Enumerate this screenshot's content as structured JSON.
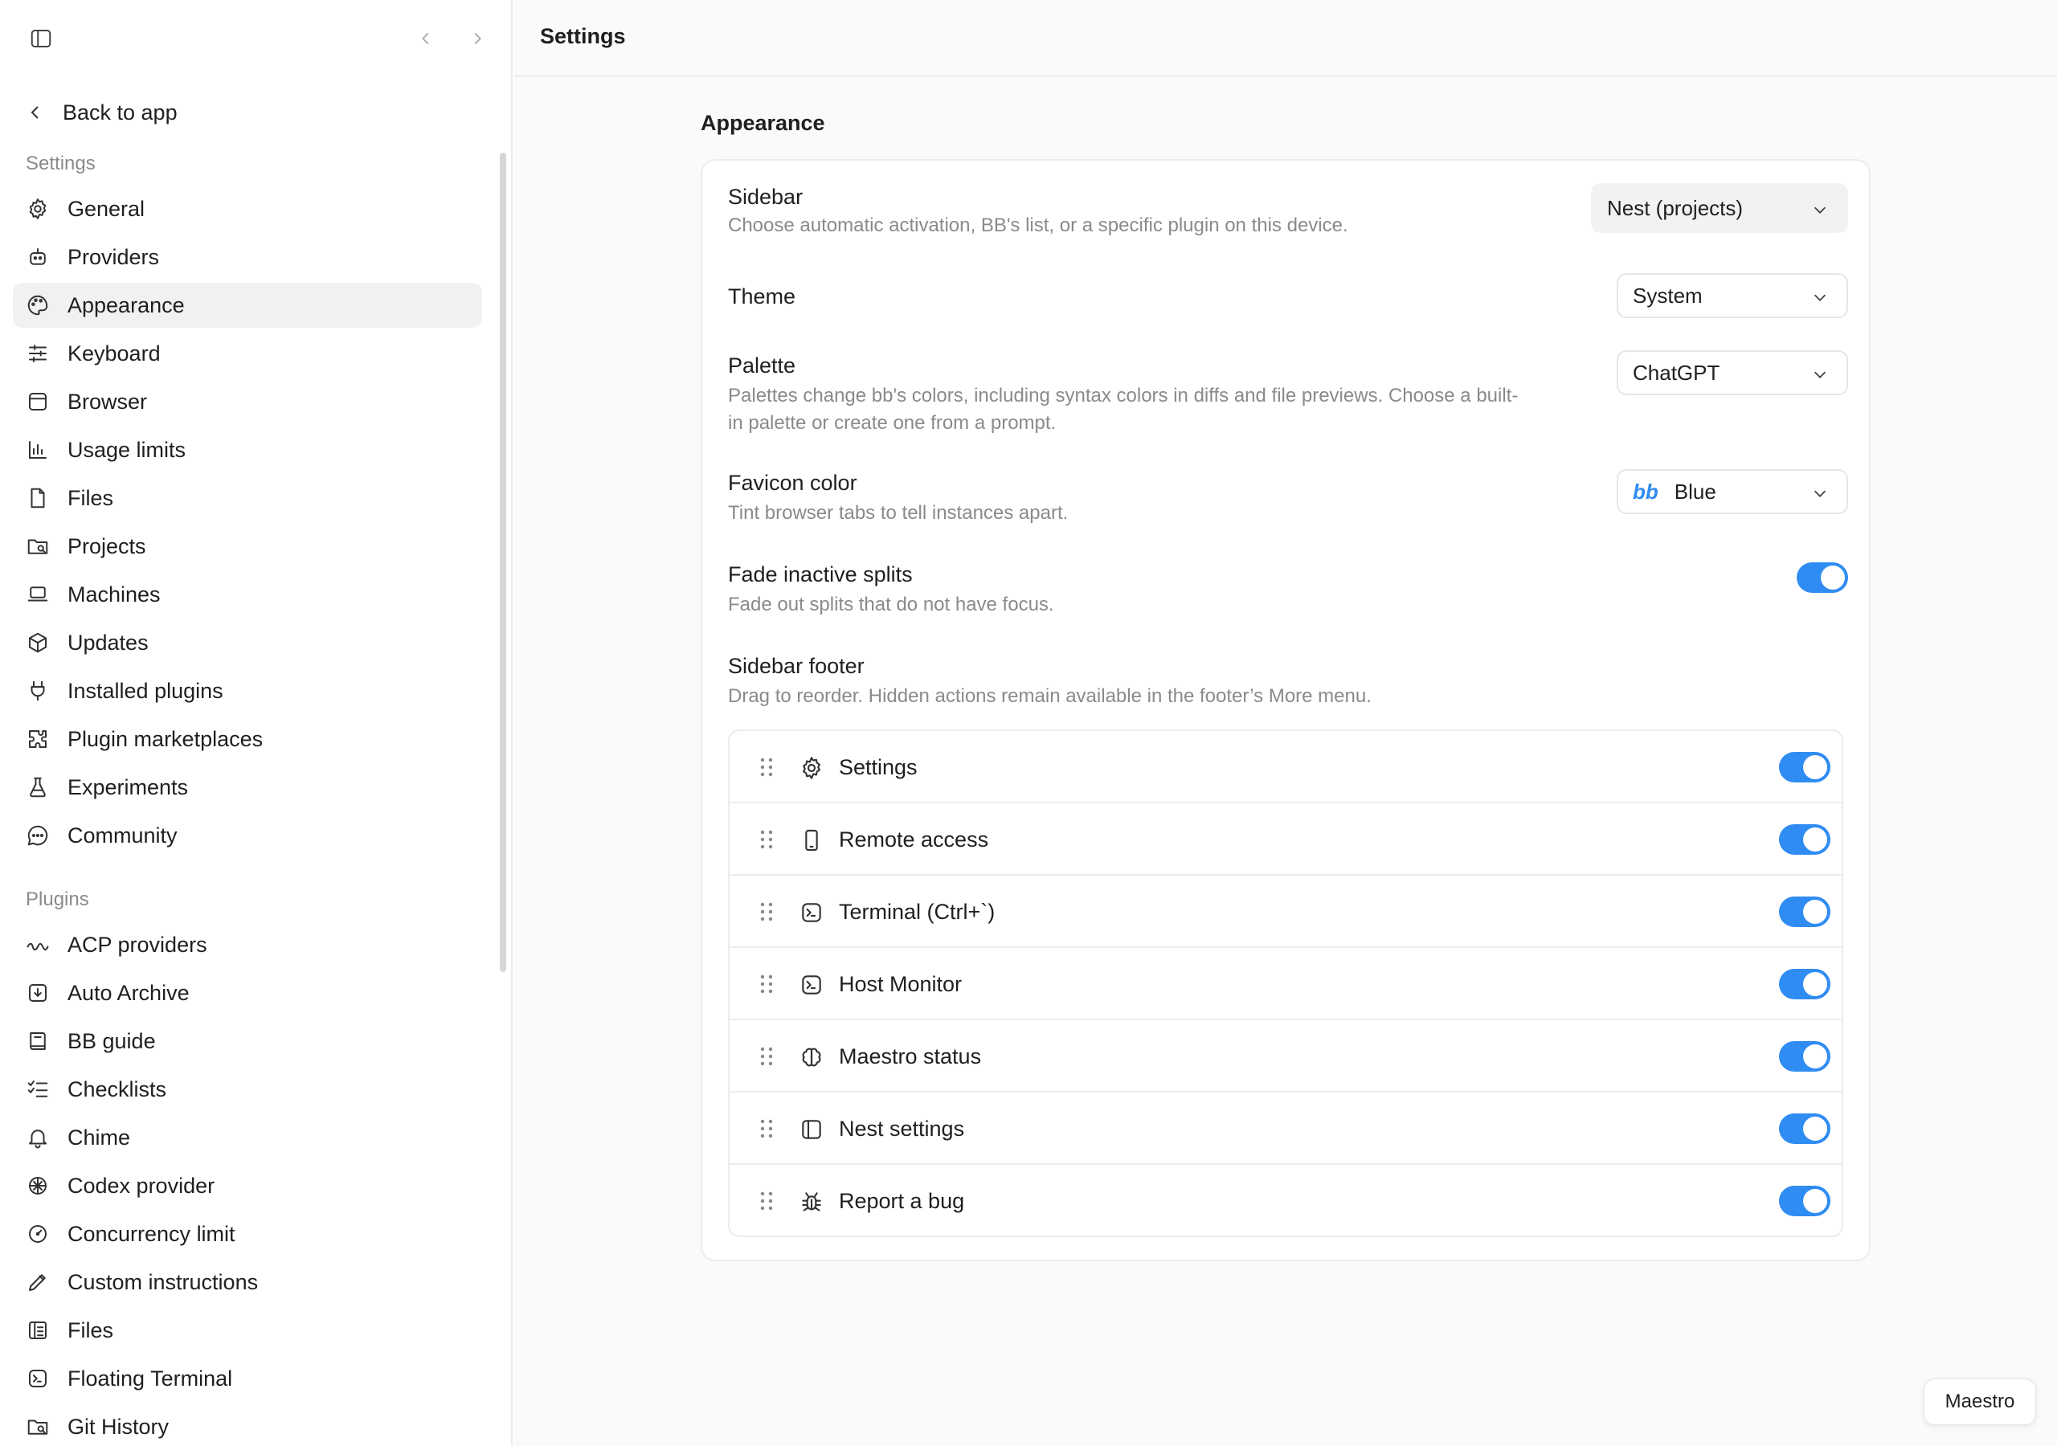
{
  "sidebar": {
    "back_label": "Back to app",
    "settings_title": "Settings",
    "plugins_title": "Plugins",
    "settings_items": [
      {
        "label": "General",
        "icon": "gear-icon"
      },
      {
        "label": "Providers",
        "icon": "robot-icon"
      },
      {
        "label": "Appearance",
        "icon": "palette-icon",
        "active": true
      },
      {
        "label": "Keyboard",
        "icon": "sliders-icon"
      },
      {
        "label": "Browser",
        "icon": "browser-window-icon"
      },
      {
        "label": "Usage limits",
        "icon": "bar-chart-icon"
      },
      {
        "label": "Files",
        "icon": "file-icon"
      },
      {
        "label": "Projects",
        "icon": "folder-search-icon"
      },
      {
        "label": "Machines",
        "icon": "laptop-icon"
      },
      {
        "label": "Updates",
        "icon": "package-icon"
      },
      {
        "label": "Installed plugins",
        "icon": "plug-icon"
      },
      {
        "label": "Plugin marketplaces",
        "icon": "puzzle-icon"
      },
      {
        "label": "Experiments",
        "icon": "flask-icon"
      },
      {
        "label": "Community",
        "icon": "chat-bubble-icon"
      }
    ],
    "plugin_items": [
      {
        "label": "ACP providers",
        "icon": "wave-icon"
      },
      {
        "label": "Auto Archive",
        "icon": "archive-icon"
      },
      {
        "label": "BB guide",
        "icon": "book-icon"
      },
      {
        "label": "Checklists",
        "icon": "checklist-icon"
      },
      {
        "label": "Chime",
        "icon": "bell-icon"
      },
      {
        "label": "Codex provider",
        "icon": "openai-icon"
      },
      {
        "label": "Concurrency limit",
        "icon": "gauge-icon"
      },
      {
        "label": "Custom instructions",
        "icon": "pencil-icon"
      },
      {
        "label": "Files",
        "icon": "file-list-icon"
      },
      {
        "label": "Floating Terminal",
        "icon": "terminal-icon"
      },
      {
        "label": "Git History",
        "icon": "folder-search-icon"
      }
    ]
  },
  "header": {
    "title": "Settings"
  },
  "appearance": {
    "heading": "Appearance",
    "sidebar_label": "Sidebar",
    "sidebar_desc": "Choose automatic activation, BB's list, or a specific plugin on this device.",
    "sidebar_value": "Nest (projects)",
    "theme_label": "Theme",
    "theme_value": "System",
    "palette_label": "Palette",
    "palette_desc_1": "Palettes change bb's colors, including syntax colors in diffs and file previews. Choose a built-",
    "palette_desc_2": "in palette or create one from a prompt.",
    "palette_value": "ChatGPT",
    "favicon_label": "Favicon color",
    "favicon_desc": "Tint browser tabs to tell instances apart.",
    "favicon_value": "Blue",
    "favicon_badge": "bb",
    "fade_label": "Fade inactive splits",
    "fade_desc": "Fade out splits that do not have focus.",
    "fade_on": true,
    "footer_label": "Sidebar footer",
    "footer_desc": "Drag to reorder. Hidden actions remain available in the footer’s More menu.",
    "footer_items": [
      {
        "label": "Settings",
        "icon": "gear-icon",
        "on": true
      },
      {
        "label": "Remote access",
        "icon": "phone-icon",
        "on": true
      },
      {
        "label": "Terminal (Ctrl+`)",
        "icon": "terminal-icon",
        "on": true
      },
      {
        "label": "Host Monitor",
        "icon": "terminal-icon",
        "on": true
      },
      {
        "label": "Maestro status",
        "icon": "brain-icon",
        "on": true
      },
      {
        "label": "Nest settings",
        "icon": "sidebar-panel-icon",
        "on": true
      },
      {
        "label": "Report a bug",
        "icon": "bug-icon",
        "on": true
      }
    ]
  },
  "maestro_button": "Maestro",
  "colors": {
    "accent": "#2f8cf2",
    "favicon_blue": "#2f8cf2"
  }
}
